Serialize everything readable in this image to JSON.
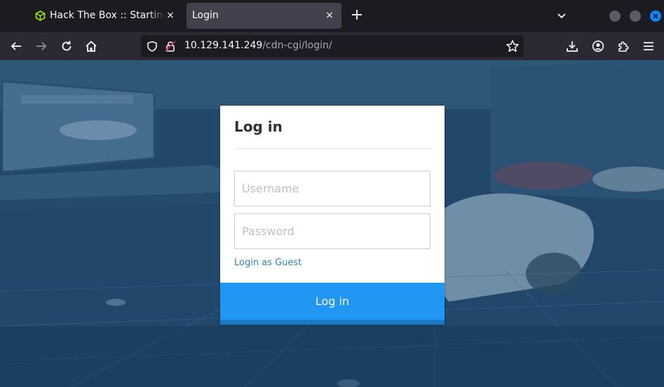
{
  "browser": {
    "tabs": [
      {
        "title": "Hack The Box :: Starting Point",
        "active": false,
        "favicon": "htb-cube-icon"
      },
      {
        "title": "Login",
        "active": true
      }
    ],
    "tab_close_glyph": "×",
    "new_tab_glyph": "+",
    "url": {
      "host": "10.129.141.249",
      "path": "/cdn-cgi/login/"
    }
  },
  "page": {
    "login": {
      "title": "Log in",
      "username_placeholder": "Username",
      "password_placeholder": "Password",
      "guest_link": "Login as Guest",
      "submit_label": "Log in"
    }
  },
  "colors": {
    "accent": "#2196f3",
    "link": "#2a85c7",
    "browser_chrome": "#2b2a33",
    "tab_strip": "#1c1b22"
  }
}
